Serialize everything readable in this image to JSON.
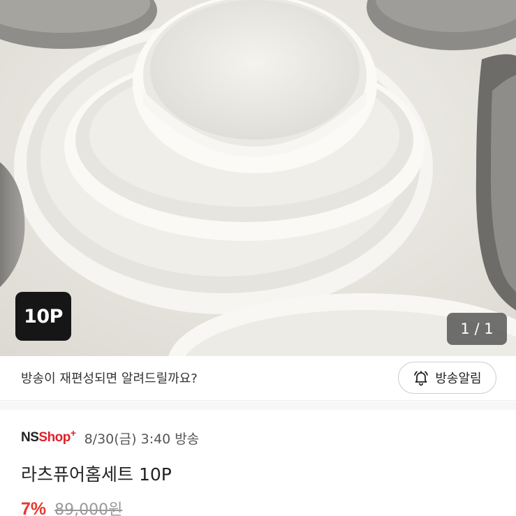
{
  "hero": {
    "image_alt": "white and gray ceramic bowls and plates",
    "qty_badge": "10P",
    "page_indicator": "1 / 1"
  },
  "notify": {
    "message": "방송이 재편성되면 알려드릴까요?",
    "button_label": "방송알림",
    "button_icon": "bell-icon"
  },
  "broadcast": {
    "channel_logo": {
      "ns": "NS",
      "shop": "Shop",
      "plus": "+"
    },
    "info": "8/30(금) 3:40 방송"
  },
  "product": {
    "title": "라츠퓨어홈세트 10P",
    "discount": "7%",
    "original_price": "89,000원"
  },
  "colors": {
    "accent_red": "#e8382f",
    "logo_red": "#e0202a",
    "badge_bg": "#161616"
  }
}
